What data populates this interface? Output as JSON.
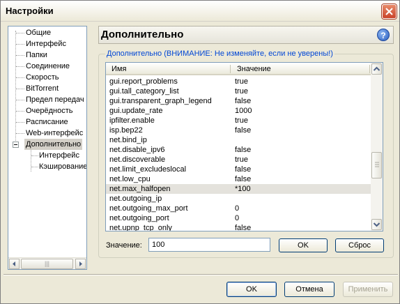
{
  "window": {
    "title": "Настройки"
  },
  "sidebar": {
    "items": [
      {
        "label": "Общие"
      },
      {
        "label": "Интерфейс"
      },
      {
        "label": "Папки"
      },
      {
        "label": "Соединение"
      },
      {
        "label": "Скорость"
      },
      {
        "label": "BitTorrent"
      },
      {
        "label": "Предел передач"
      },
      {
        "label": "Очерёдность"
      },
      {
        "label": "Расписание"
      },
      {
        "label": "Web-интерфейс"
      },
      {
        "label": "Дополнительно"
      },
      {
        "label": "Интерфейс"
      },
      {
        "label": "Кэширование"
      }
    ],
    "selected_index": 10
  },
  "main": {
    "title": "Дополнительно",
    "group_label": "Дополнительно (ВНИМАНИЕ: Не изменяйте, если не уверены!)",
    "columns": {
      "name": "Имя",
      "value": "Значение"
    },
    "rows": [
      {
        "name": "gui.report_problems",
        "value": "true"
      },
      {
        "name": "gui.tall_category_list",
        "value": "true"
      },
      {
        "name": "gui.transparent_graph_legend",
        "value": "false"
      },
      {
        "name": "gui.update_rate",
        "value": "1000"
      },
      {
        "name": "ipfilter.enable",
        "value": "true"
      },
      {
        "name": "isp.bep22",
        "value": "false"
      },
      {
        "name": "net.bind_ip",
        "value": ""
      },
      {
        "name": "net.disable_ipv6",
        "value": "false"
      },
      {
        "name": "net.discoverable",
        "value": "true"
      },
      {
        "name": "net.limit_excludeslocal",
        "value": "false"
      },
      {
        "name": "net.low_cpu",
        "value": "false"
      },
      {
        "name": "net.max_halfopen",
        "value": "*100"
      },
      {
        "name": "net.outgoing_ip",
        "value": ""
      },
      {
        "name": "net.outgoing_max_port",
        "value": "0"
      },
      {
        "name": "net.outgoing_port",
        "value": "0"
      },
      {
        "name": "net.upnp_tcp_only",
        "value": "false"
      }
    ],
    "highlighted_row": 11,
    "value_label": "Значение:",
    "value_input": "100",
    "ok_label": "OK",
    "reset_label": "Сброс"
  },
  "footer": {
    "ok_label": "OK",
    "cancel_label": "Отмена",
    "apply_label": "Применить"
  }
}
